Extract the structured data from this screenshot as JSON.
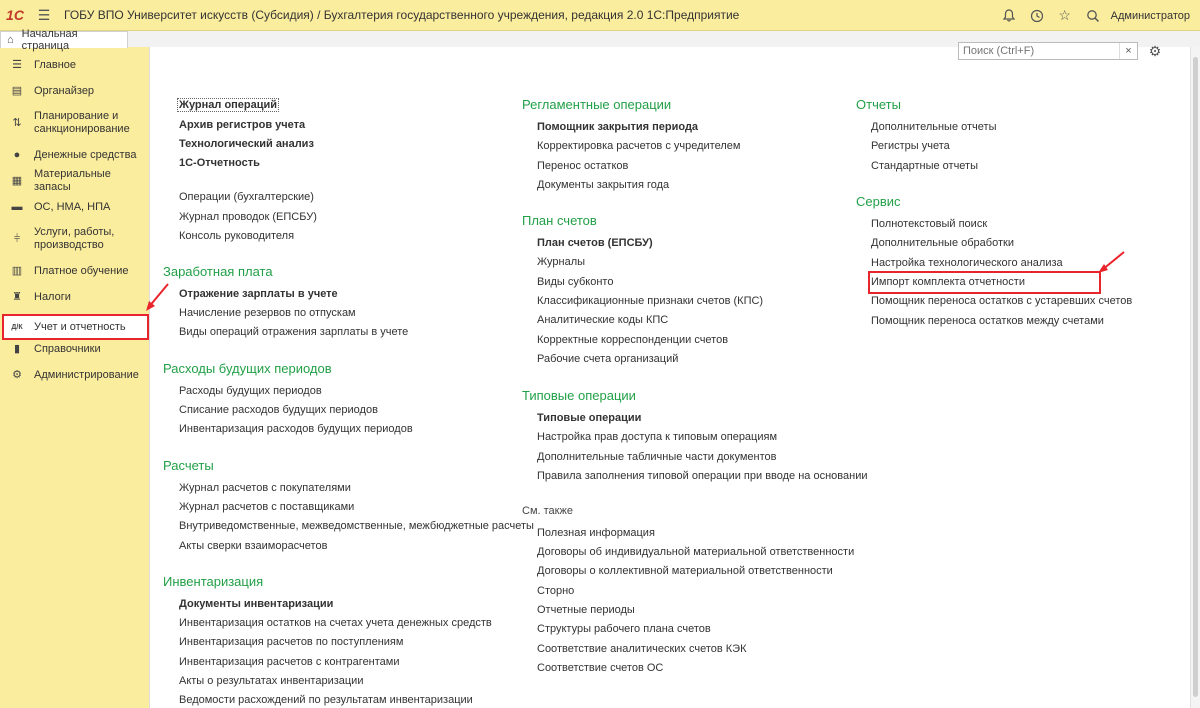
{
  "titlebar": {
    "logo": "1С",
    "title": "ГОБУ ВПО Университет искусств (Субсидия) / Бухгалтерия государственного учреждения, редакция 2.0 1С:Предприятие",
    "user": "Администратор",
    "icons": [
      "menu-icon",
      "bell-icon",
      "history-icon",
      "star-icon",
      "search-icon"
    ]
  },
  "home_tab": {
    "label": "Начальная страница",
    "icon": "home-icon"
  },
  "sidebar": {
    "items": [
      {
        "label": "Главное",
        "icon": "list-icon"
      },
      {
        "label": "Органайзер",
        "icon": "clipboard-icon"
      },
      {
        "label": "Планирование и санкционирование",
        "icon": "plan-icon"
      },
      {
        "label": "Денежные средства",
        "icon": "coin-icon"
      },
      {
        "label": "Материальные запасы",
        "icon": "grid-icon"
      },
      {
        "label": "ОС, НМА, НПА",
        "icon": "truck-icon"
      },
      {
        "label": "Услуги, работы, производство",
        "icon": "tools-icon"
      },
      {
        "label": "Платное обучение",
        "icon": "building-icon"
      },
      {
        "label": "Налоги",
        "icon": "eagle-icon"
      },
      {
        "label": "Учет и отчетность",
        "icon": "debit-credit-icon",
        "active": true
      },
      {
        "label": "Справочники",
        "icon": "books-icon"
      },
      {
        "label": "Администрирование",
        "icon": "gear-icon"
      }
    ]
  },
  "search": {
    "placeholder": "Поиск (Ctrl+F)",
    "clear": "×"
  },
  "settings_icon": "⚙",
  "col1": {
    "top_links": [
      {
        "label": "Журнал операций",
        "bold": true,
        "focused": true
      },
      {
        "label": "Архив регистров учета",
        "bold": true
      },
      {
        "label": "Технологический анализ",
        "bold": true
      },
      {
        "label": "1С-Отчетность",
        "bold": true
      },
      {
        "label": "Операции (бухгалтерские)"
      },
      {
        "label": "Журнал проводок (ЕПСБУ)"
      },
      {
        "label": "Консоль руководителя"
      }
    ],
    "salary": {
      "title": "Заработная плата",
      "links": [
        {
          "label": "Отражение зарплаты в учете",
          "bold": true
        },
        {
          "label": "Начисление резервов по отпускам"
        },
        {
          "label": "Виды операций отражения зарплаты в учете"
        }
      ]
    },
    "deferred": {
      "title": "Расходы будущих периодов",
      "links": [
        {
          "label": "Расходы будущих периодов"
        },
        {
          "label": "Списание расходов будущих периодов"
        },
        {
          "label": "Инвентаризация расходов будущих периодов"
        }
      ]
    },
    "settlements": {
      "title": "Расчеты",
      "links": [
        {
          "label": "Журнал расчетов с покупателями"
        },
        {
          "label": "Журнал расчетов с поставщиками"
        },
        {
          "label": "Внутриведомственные, межведомственные, межбюджетные расчеты"
        },
        {
          "label": "Акты сверки взаиморасчетов"
        }
      ]
    },
    "inventory": {
      "title": "Инвентаризация",
      "links": [
        {
          "label": "Документы инвентаризации",
          "bold": true
        },
        {
          "label": "Инвентаризация остатков на счетах учета денежных средств"
        },
        {
          "label": "Инвентаризация расчетов по поступлениям"
        },
        {
          "label": "Инвентаризация расчетов с контрагентами"
        },
        {
          "label": "Акты о результатах инвентаризации"
        },
        {
          "label": "Ведомости расхождений по результатам инвентаризации"
        }
      ]
    }
  },
  "col2": {
    "regular": {
      "title": "Регламентные операции",
      "links": [
        {
          "label": "Помощник закрытия периода",
          "bold": true
        },
        {
          "label": "Корректировка расчетов с учредителем"
        },
        {
          "label": "Перенос остатков"
        },
        {
          "label": "Документы закрытия года"
        }
      ]
    },
    "chart": {
      "title": "План счетов",
      "links": [
        {
          "label": "План счетов (ЕПСБУ)",
          "bold": true
        },
        {
          "label": "Журналы"
        },
        {
          "label": "Виды субконто"
        },
        {
          "label": "Классификационные признаки счетов (КПС)"
        },
        {
          "label": "Аналитические коды КПС"
        },
        {
          "label": "Корректные корреспонденции счетов"
        },
        {
          "label": "Рабочие счета организаций"
        }
      ]
    },
    "typical": {
      "title": "Типовые операции",
      "links": [
        {
          "label": "Типовые операции",
          "bold": true
        },
        {
          "label": "Настройка прав доступа к типовым операциям"
        },
        {
          "label": "Дополнительные табличные части документов"
        },
        {
          "label": "Правила заполнения типовой операции при вводе на основании"
        }
      ]
    },
    "see_also": {
      "title": "См. также",
      "links": [
        {
          "label": "Полезная информация"
        },
        {
          "label": "Договоры об индивидуальной материальной ответственности"
        },
        {
          "label": "Договоры о коллективной материальной ответственности"
        },
        {
          "label": "Сторно"
        },
        {
          "label": "Отчетные периоды"
        },
        {
          "label": "Структуры рабочего плана счетов"
        },
        {
          "label": "Соответствие аналитических счетов КЭК"
        },
        {
          "label": "Соответствие счетов ОС"
        }
      ]
    }
  },
  "col3": {
    "reports": {
      "title": "Отчеты",
      "links": [
        {
          "label": "Дополнительные отчеты"
        },
        {
          "label": "Регистры учета"
        },
        {
          "label": "Стандартные отчеты"
        }
      ]
    },
    "service": {
      "title": "Сервис",
      "links": [
        {
          "label": "Полнотекстовый поиск"
        },
        {
          "label": "Дополнительные обработки"
        },
        {
          "label": "Настройка технологического анализа"
        },
        {
          "label": "Импорт комплекта отчетности"
        },
        {
          "label": "Помощник переноса остатков с устаревших счетов"
        },
        {
          "label": "Помощник переноса остатков между счетами"
        }
      ]
    }
  },
  "colors": {
    "accent_green": "#22a047",
    "sidebar_bg": "#fbed9e",
    "highlight_red": "#e8242c"
  }
}
